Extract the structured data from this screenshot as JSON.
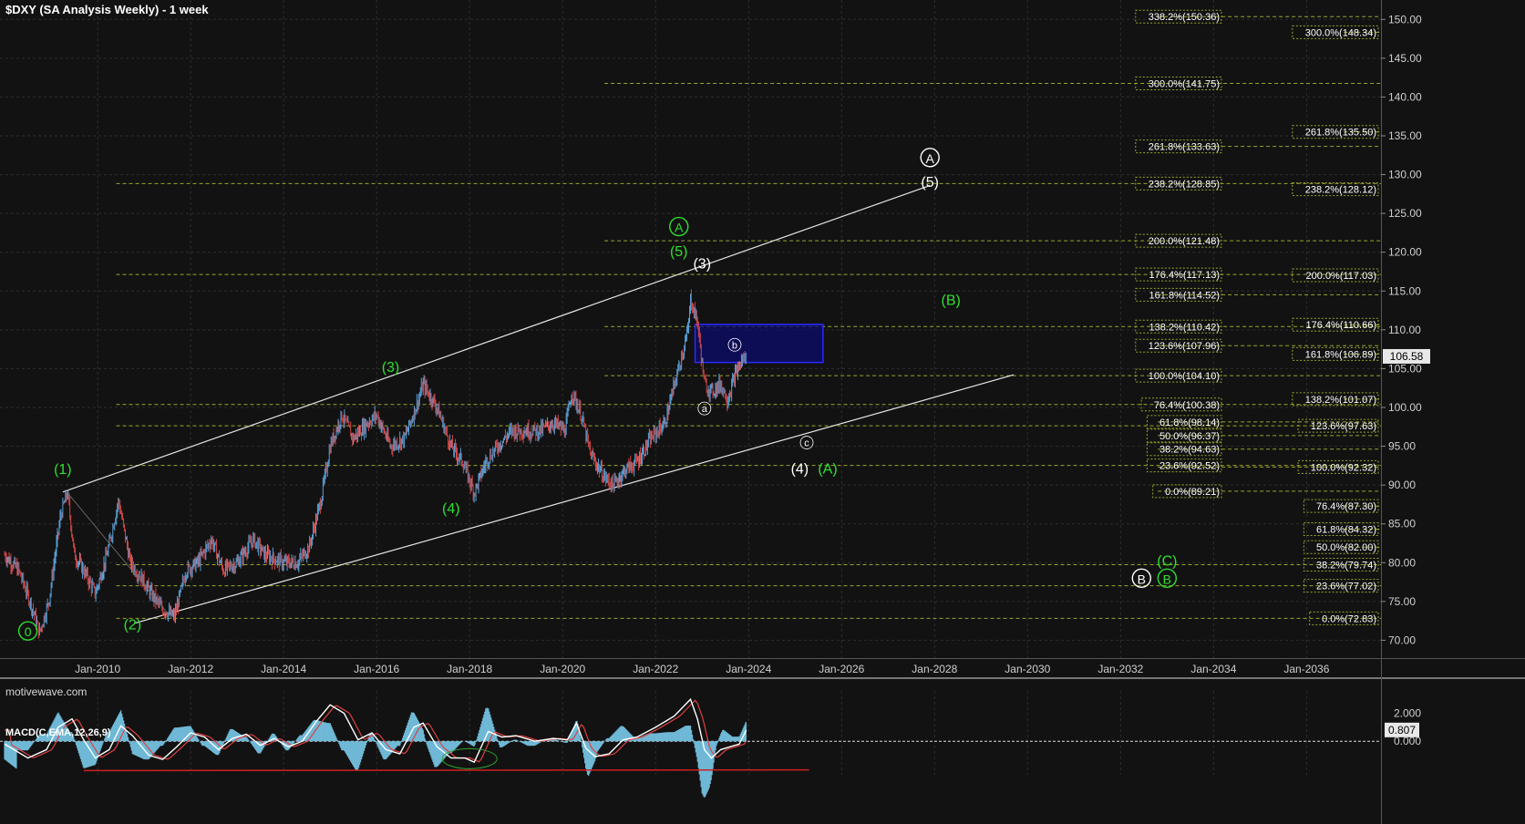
{
  "title": "$DXY (SA Analysis Weekly) - 1 week",
  "watermark": "motivewave.com",
  "macd_title": "MACD(C,EMA,12,26,9)",
  "colors": {
    "background": "#121212",
    "grid": "#2e2e2e",
    "fib": "#9aa52a",
    "green_label": "#2fe02f",
    "white_label": "#ffffff",
    "candle_up": "#5aa0d8",
    "candle_down": "#d04848",
    "box_fill": "#0c0c6e",
    "box_stroke": "#2a2aff",
    "macd_hist": "#6fb8d6",
    "macd_line": "#ffffff",
    "signal_line": "#e04040"
  },
  "chart_data": {
    "type": "candlestick",
    "x_ticks": [
      "Jan-2010",
      "Jan-2012",
      "Jan-2014",
      "Jan-2016",
      "Jan-2018",
      "Jan-2020",
      "Jan-2022",
      "Jan-2024",
      "Jan-2026",
      "Jan-2028",
      "Jan-2030",
      "Jan-2032",
      "Jan-2034",
      "Jan-2036"
    ],
    "x_range": [
      2007.9,
      2037.6
    ],
    "y_ticks": [
      "70.00",
      "75.00",
      "80.00",
      "85.00",
      "90.00",
      "95.00",
      "100.00",
      "105.00",
      "110.00",
      "115.00",
      "120.00",
      "125.00",
      "130.00",
      "135.00",
      "140.00",
      "145.00",
      "150.00"
    ],
    "y_range": [
      67.7,
      152.5
    ],
    "last_price": "106.58",
    "price_path": [
      [
        2008.0,
        81
      ],
      [
        2008.3,
        79
      ],
      [
        2008.55,
        75
      ],
      [
        2008.75,
        71
      ],
      [
        2008.95,
        75
      ],
      [
        2009.2,
        86
      ],
      [
        2009.35,
        89
      ],
      [
        2009.5,
        81
      ],
      [
        2009.7,
        79
      ],
      [
        2009.95,
        76
      ],
      [
        2010.2,
        81
      ],
      [
        2010.45,
        88
      ],
      [
        2010.7,
        80
      ],
      [
        2010.95,
        78
      ],
      [
        2011.15,
        76
      ],
      [
        2011.4,
        74
      ],
      [
        2011.65,
        73
      ],
      [
        2011.9,
        79
      ],
      [
        2012.15,
        80
      ],
      [
        2012.45,
        83
      ],
      [
        2012.7,
        79
      ],
      [
        2013.0,
        80
      ],
      [
        2013.35,
        83
      ],
      [
        2013.6,
        81
      ],
      [
        2014.0,
        80
      ],
      [
        2014.3,
        80
      ],
      [
        2014.55,
        82
      ],
      [
        2014.8,
        88
      ],
      [
        2015.0,
        95
      ],
      [
        2015.25,
        99
      ],
      [
        2015.5,
        96
      ],
      [
        2015.8,
        98
      ],
      [
        2016.0,
        99
      ],
      [
        2016.3,
        95
      ],
      [
        2016.6,
        96
      ],
      [
        2016.9,
        101
      ],
      [
        2017.0,
        103
      ],
      [
        2017.3,
        100
      ],
      [
        2017.6,
        95
      ],
      [
        2017.85,
        93
      ],
      [
        2018.1,
        89
      ],
      [
        2018.35,
        93
      ],
      [
        2018.6,
        95
      ],
      [
        2018.9,
        97
      ],
      [
        2019.2,
        97
      ],
      [
        2019.5,
        97
      ],
      [
        2019.8,
        98
      ],
      [
        2020.05,
        97
      ],
      [
        2020.2,
        102
      ],
      [
        2020.4,
        99
      ],
      [
        2020.6,
        94
      ],
      [
        2020.9,
        91
      ],
      [
        2021.1,
        90
      ],
      [
        2021.35,
        92
      ],
      [
        2021.6,
        93
      ],
      [
        2021.9,
        96
      ],
      [
        2022.2,
        98
      ],
      [
        2022.45,
        104
      ],
      [
        2022.7,
        110
      ],
      [
        2022.75,
        114
      ],
      [
        2022.9,
        111
      ],
      [
        2023.05,
        103
      ],
      [
        2023.2,
        102
      ],
      [
        2023.4,
        103
      ],
      [
        2023.55,
        101
      ],
      [
        2023.7,
        104
      ],
      [
        2023.85,
        106
      ],
      [
        2023.95,
        106.6
      ]
    ],
    "fib_labels": [
      {
        "text": "338.2%(150.36)",
        "v": 150.36,
        "col": 1
      },
      {
        "text": "300.0%(148.34)",
        "v": 148.34,
        "col": 2
      },
      {
        "text": "300.0%(141.75)",
        "v": 141.75,
        "col": 1
      },
      {
        "text": "261.8%(135.50)",
        "v": 135.5,
        "col": 2
      },
      {
        "text": "261.8%(133.63)",
        "v": 133.63,
        "col": 1
      },
      {
        "text": "238.2%(128.85)",
        "v": 128.85,
        "col": 1
      },
      {
        "text": "238.2%(128.12)",
        "v": 128.12,
        "col": 2
      },
      {
        "text": "200.0%(121.48)",
        "v": 121.48,
        "col": 1
      },
      {
        "text": "176.4%(117.13)",
        "v": 117.13,
        "col": 1
      },
      {
        "text": "200.0%(117.03)",
        "v": 117.03,
        "col": 2
      },
      {
        "text": "161.8%(114.52)",
        "v": 114.52,
        "col": 1
      },
      {
        "text": "176.4%(110.66)",
        "v": 110.66,
        "col": 2
      },
      {
        "text": "138.2%(110.42)",
        "v": 110.42,
        "col": 1
      },
      {
        "text": "123.6%(107.96)",
        "v": 107.96,
        "col": 1
      },
      {
        "text": "161.8%(106.89)",
        "v": 106.89,
        "col": 2
      },
      {
        "text": "100.0%(104.10)",
        "v": 104.1,
        "col": 1
      },
      {
        "text": "138.2%(101.07)",
        "v": 101.07,
        "col": 2
      },
      {
        "text": "76.4%(100.38)",
        "v": 100.38,
        "col": 1
      },
      {
        "text": "61.8%(98.14)",
        "v": 98.14,
        "col": 1
      },
      {
        "text": "123.6%(97.63)",
        "v": 97.63,
        "col": 2
      },
      {
        "text": "50.0%(96.37)",
        "v": 96.37,
        "col": 1
      },
      {
        "text": "38.2%(94.63)",
        "v": 94.63,
        "col": 1
      },
      {
        "text": "23.6%(92.52)",
        "v": 92.52,
        "col": 1
      },
      {
        "text": "100.0%(92.32)",
        "v": 92.32,
        "col": 2
      },
      {
        "text": "0.0%(89.21)",
        "v": 89.21,
        "col": 1
      },
      {
        "text": "76.4%(87.30)",
        "v": 87.3,
        "col": 2
      },
      {
        "text": "61.8%(84.32)",
        "v": 84.32,
        "col": 2
      },
      {
        "text": "50.0%(82.00)",
        "v": 82.0,
        "col": 2
      },
      {
        "text": "38.2%(79.74)",
        "v": 79.74,
        "col": 2
      },
      {
        "text": "23.6%(77.02)",
        "v": 77.02,
        "col": 2
      },
      {
        "text": "0.0%(72.83)",
        "v": 72.83,
        "col": 2
      }
    ],
    "wave_labels": [
      {
        "text": "0",
        "x": 2008.5,
        "v": 70.5,
        "color": "green",
        "circled": true
      },
      {
        "text": "(1)",
        "x": 2009.25,
        "v": 91.4,
        "color": "green"
      },
      {
        "text": "(2)",
        "x": 2010.75,
        "v": 71.4,
        "color": "green"
      },
      {
        "text": "(3)",
        "x": 2016.3,
        "v": 104.6,
        "color": "green"
      },
      {
        "text": "(4)",
        "x": 2017.6,
        "v": 86.4,
        "color": "green"
      },
      {
        "text": "(5)",
        "x": 2022.5,
        "v": 119.5,
        "color": "green"
      },
      {
        "text": "A",
        "x": 2022.5,
        "v": 122.6,
        "color": "green",
        "circled": true
      },
      {
        "text": "(3)",
        "x": 2023.0,
        "v": 117.9,
        "color": "white"
      },
      {
        "text": "(b)",
        "x": 2023.7,
        "v": 107.6,
        "color": "white",
        "small": true
      },
      {
        "text": "(a)",
        "x": 2023.05,
        "v": 99.4,
        "color": "white",
        "small": true
      },
      {
        "text": "(c)",
        "x": 2025.25,
        "v": 95.0,
        "color": "white",
        "small": true
      },
      {
        "text": "(4)",
        "x": 2025.1,
        "v": 91.5,
        "color": "white"
      },
      {
        "text": "(A)",
        "x": 2025.7,
        "v": 91.5,
        "color": "green"
      },
      {
        "text": "(5)",
        "x": 2027.9,
        "v": 128.4,
        "color": "white"
      },
      {
        "text": "A",
        "x": 2027.9,
        "v": 131.5,
        "color": "white",
        "circled": true
      },
      {
        "text": "(B)",
        "x": 2028.35,
        "v": 113.2,
        "color": "green"
      },
      {
        "text": "(C)",
        "x": 2033.0,
        "v": 79.6,
        "color": "green"
      },
      {
        "text": "B",
        "x": 2032.45,
        "v": 77.3,
        "color": "white",
        "circled": true
      },
      {
        "text": "B",
        "x": 2033.0,
        "v": 77.3,
        "color": "green",
        "circled": true
      }
    ],
    "channel_upper": [
      [
        2009.25,
        89.1
      ],
      [
        2027.9,
        128.6
      ]
    ],
    "channel_lower": [
      [
        2010.8,
        72.2
      ],
      [
        2029.7,
        104.2
      ]
    ],
    "target_box": {
      "x0": 2022.85,
      "x1": 2025.6,
      "v0": 105.8,
      "v1": 110.7
    },
    "fib_lines": [
      {
        "v": 150.36,
        "x0": 2032.8,
        "x1": 2037.6
      },
      {
        "v": 148.34,
        "x0": 2036.8,
        "x1": 2037.6
      },
      {
        "v": 141.75,
        "x0": 2020.9,
        "x1": 2037.6
      },
      {
        "v": 135.5,
        "x0": 2036.8,
        "x1": 2037.6
      },
      {
        "v": 133.63,
        "x0": 2032.8,
        "x1": 2037.6
      },
      {
        "v": 128.85,
        "x0": 2010.4,
        "x1": 2037.6
      },
      {
        "v": 121.48,
        "x0": 2020.9,
        "x1": 2037.6
      },
      {
        "v": 117.13,
        "x0": 2010.4,
        "x1": 2037.6
      },
      {
        "v": 114.52,
        "x0": 2032.8,
        "x1": 2037.6
      },
      {
        "v": 110.66,
        "x0": 2036.8,
        "x1": 2037.6
      },
      {
        "v": 110.42,
        "x0": 2020.9,
        "x1": 2037.6
      },
      {
        "v": 107.96,
        "x0": 2032.8,
        "x1": 2037.6
      },
      {
        "v": 106.89,
        "x0": 2036.8,
        "x1": 2037.6
      },
      {
        "v": 104.1,
        "x0": 2020.9,
        "x1": 2037.6
      },
      {
        "v": 101.07,
        "x0": 2036.8,
        "x1": 2037.6
      },
      {
        "v": 100.38,
        "x0": 2010.4,
        "x1": 2037.6
      },
      {
        "v": 98.14,
        "x0": 2032.8,
        "x1": 2037.6
      },
      {
        "v": 97.63,
        "x0": 2010.4,
        "x1": 2037.6
      },
      {
        "v": 96.37,
        "x0": 2032.8,
        "x1": 2037.6
      },
      {
        "v": 94.63,
        "x0": 2032.8,
        "x1": 2037.6
      },
      {
        "v": 92.52,
        "x0": 2010.4,
        "x1": 2037.6
      },
      {
        "v": 92.32,
        "x0": 2032.8,
        "x1": 2037.6
      },
      {
        "v": 89.21,
        "x0": 2032.8,
        "x1": 2037.6
      },
      {
        "v": 87.3,
        "x0": 2036.8,
        "x1": 2037.6
      },
      {
        "v": 84.32,
        "x0": 2036.8,
        "x1": 2037.6
      },
      {
        "v": 82.0,
        "x0": 2036.8,
        "x1": 2037.6
      },
      {
        "v": 79.74,
        "x0": 2010.4,
        "x1": 2037.6
      },
      {
        "v": 77.02,
        "x0": 2010.4,
        "x1": 2037.6
      },
      {
        "v": 72.83,
        "x0": 2010.4,
        "x1": 2037.6
      }
    ],
    "macd": {
      "y_ticks": [
        "2.000",
        "0.000"
      ],
      "y_range": [
        -2.4,
        3.6
      ],
      "last_value": "0.807",
      "line": [
        [
          2008.0,
          -0.2
        ],
        [
          2008.5,
          -1.2
        ],
        [
          2008.9,
          -0.6
        ],
        [
          2009.15,
          1.0
        ],
        [
          2009.45,
          1.6
        ],
        [
          2009.7,
          0.1
        ],
        [
          2009.95,
          -1.2
        ],
        [
          2010.25,
          -0.6
        ],
        [
          2010.5,
          1.1
        ],
        [
          2010.75,
          0.4
        ],
        [
          2011.1,
          -1.0
        ],
        [
          2011.4,
          -1.3
        ],
        [
          2011.7,
          -0.4
        ],
        [
          2012.0,
          0.6
        ],
        [
          2012.3,
          0.3
        ],
        [
          2012.6,
          -0.6
        ],
        [
          2012.9,
          0.2
        ],
        [
          2013.2,
          0.5
        ],
        [
          2013.5,
          -0.3
        ],
        [
          2013.8,
          0.2
        ],
        [
          2014.1,
          -0.4
        ],
        [
          2014.4,
          0.0
        ],
        [
          2014.7,
          1.4
        ],
        [
          2015.0,
          2.6
        ],
        [
          2015.3,
          2.0
        ],
        [
          2015.6,
          0.1
        ],
        [
          2015.9,
          0.6
        ],
        [
          2016.2,
          -0.6
        ],
        [
          2016.5,
          -0.9
        ],
        [
          2016.8,
          1.0
        ],
        [
          2017.0,
          1.3
        ],
        [
          2017.3,
          -0.4
        ],
        [
          2017.6,
          -1.2
        ],
        [
          2017.9,
          -1.2
        ],
        [
          2018.1,
          -1.5
        ],
        [
          2018.4,
          0.7
        ],
        [
          2018.7,
          0.3
        ],
        [
          2019.0,
          0.4
        ],
        [
          2019.4,
          0.0
        ],
        [
          2019.8,
          0.2
        ],
        [
          2020.1,
          0.1
        ],
        [
          2020.3,
          1.3
        ],
        [
          2020.5,
          -0.5
        ],
        [
          2020.7,
          -1.1
        ],
        [
          2021.0,
          -0.9
        ],
        [
          2021.3,
          0.1
        ],
        [
          2021.6,
          0.3
        ],
        [
          2022.0,
          1.0
        ],
        [
          2022.4,
          1.8
        ],
        [
          2022.75,
          3.0
        ],
        [
          2022.9,
          1.6
        ],
        [
          2023.05,
          -0.6
        ],
        [
          2023.2,
          -1.2
        ],
        [
          2023.4,
          -0.6
        ],
        [
          2023.6,
          -0.4
        ],
        [
          2023.8,
          -0.2
        ],
        [
          2023.95,
          0.8
        ]
      ],
      "divergence_line": [
        [
          2009.7,
          -2.1
        ],
        [
          2025.3,
          -2.05
        ]
      ]
    }
  }
}
